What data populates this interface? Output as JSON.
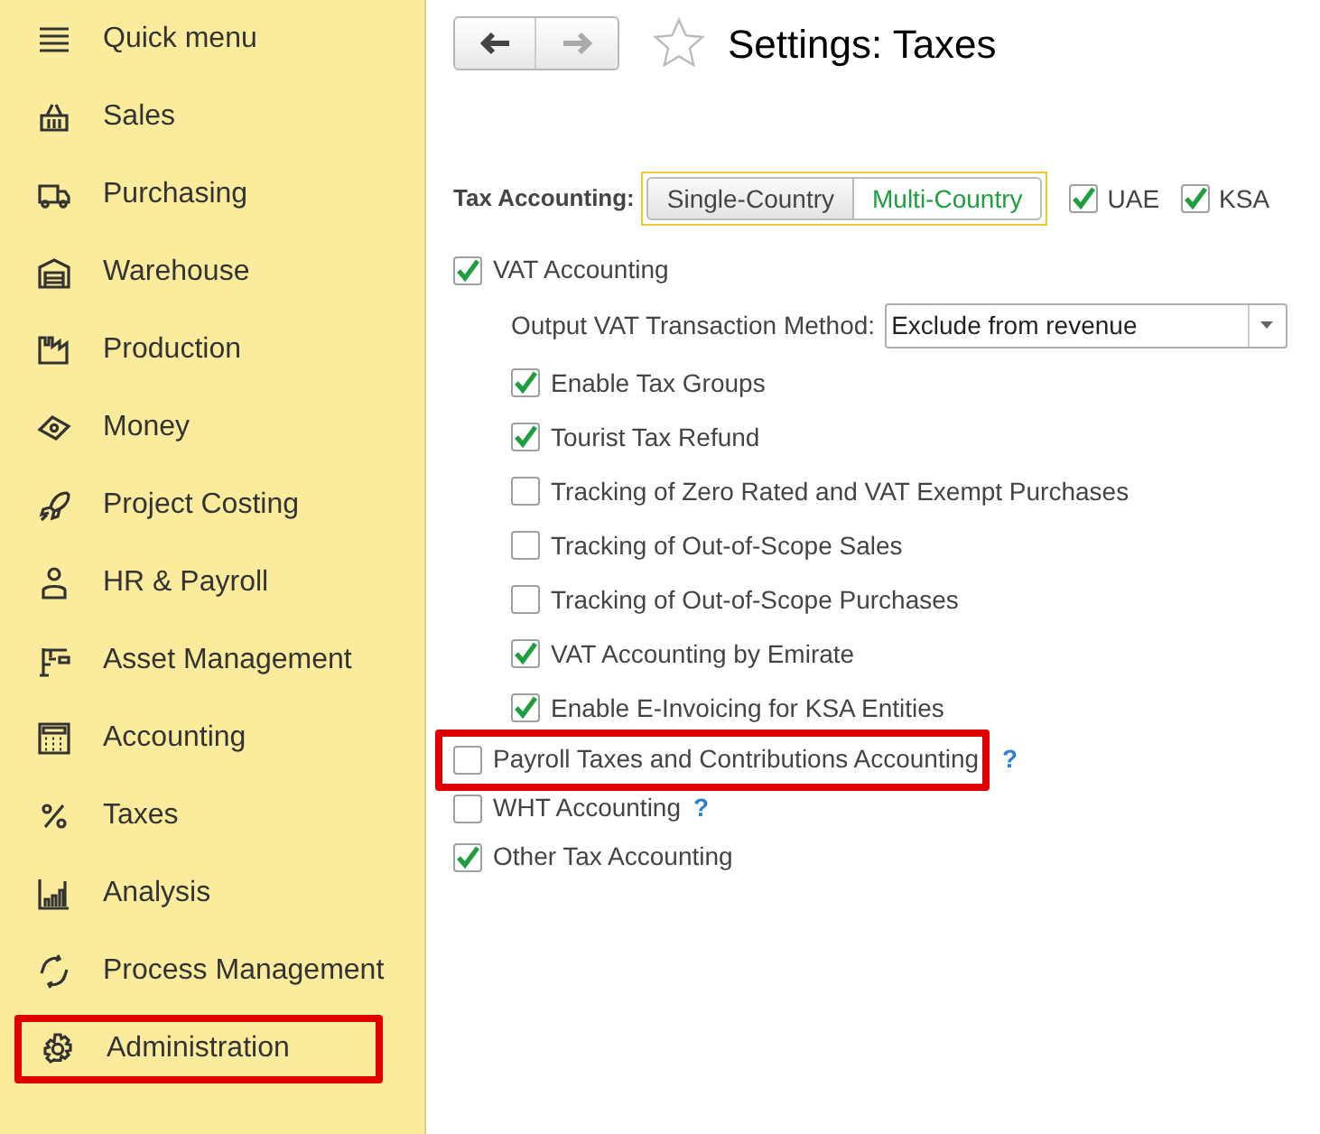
{
  "sidebar": {
    "items": [
      {
        "label": "Quick menu",
        "highlighted": false
      },
      {
        "label": "Sales",
        "highlighted": false
      },
      {
        "label": "Purchasing",
        "highlighted": false
      },
      {
        "label": "Warehouse",
        "highlighted": false
      },
      {
        "label": "Production",
        "highlighted": false
      },
      {
        "label": "Money",
        "highlighted": false
      },
      {
        "label": "Project Costing",
        "highlighted": false
      },
      {
        "label": "HR & Payroll",
        "highlighted": false
      },
      {
        "label": "Asset Management",
        "highlighted": false
      },
      {
        "label": "Accounting",
        "highlighted": false
      },
      {
        "label": "Taxes",
        "highlighted": false
      },
      {
        "label": "Analysis",
        "highlighted": false
      },
      {
        "label": "Process Management",
        "highlighted": false
      },
      {
        "label": "Administration",
        "highlighted": true
      }
    ]
  },
  "header": {
    "title": "Settings: Taxes",
    "favorite": false
  },
  "tax_accounting": {
    "label": "Tax Accounting:",
    "options": [
      {
        "label": "Single-Country",
        "selected": false
      },
      {
        "label": "Multi-Country",
        "selected": true
      }
    ],
    "countries": [
      {
        "label": "UAE",
        "checked": true
      },
      {
        "label": "KSA",
        "checked": true
      }
    ]
  },
  "settings": [
    {
      "label": "VAT Accounting",
      "checked": true,
      "highlighted": false,
      "method": {
        "label": "Output VAT Transaction Method:",
        "value": "Exclude from revenue"
      },
      "children": [
        {
          "label": "Enable Tax Groups",
          "checked": true
        },
        {
          "label": "Tourist Tax Refund",
          "checked": true
        },
        {
          "label": "Tracking of Zero Rated and VAT Exempt Purchases",
          "checked": false
        },
        {
          "label": "Tracking of Out-of-Scope Sales",
          "checked": false
        },
        {
          "label": "Tracking of Out-of-Scope Purchases",
          "checked": false
        },
        {
          "label": "VAT Accounting by Emirate",
          "checked": true
        },
        {
          "label": "Enable E-Invoicing for KSA Entities",
          "checked": true
        }
      ]
    },
    {
      "label": "Payroll Taxes and Contributions Accounting",
      "checked": false,
      "help": "?",
      "highlighted": true
    },
    {
      "label": "WHT Accounting",
      "checked": false,
      "help": "?",
      "highlighted": false
    },
    {
      "label": "Other Tax Accounting",
      "checked": true,
      "highlighted": false
    }
  ]
}
